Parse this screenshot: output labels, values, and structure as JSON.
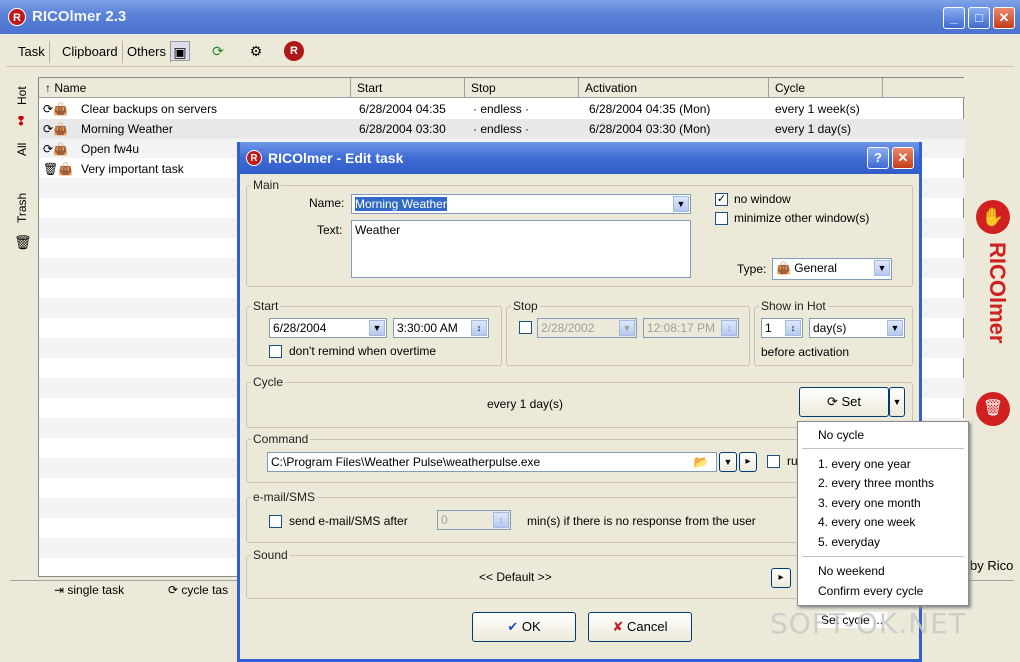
{
  "app": {
    "title": "RICOlmer 2.3",
    "logo": "R"
  },
  "toolbar": {
    "task": "Task",
    "clipboard": "Clipboard",
    "others": "Others"
  },
  "sidebar": {
    "hot": "Hot",
    "all": "All",
    "trash": "Trash"
  },
  "columns": [
    "Name",
    "Start",
    "Stop",
    "Activation",
    "Cycle"
  ],
  "rows": [
    {
      "name": "Clear backups on servers",
      "start": "6/28/2004 04:35",
      "stop": "· endless ·",
      "activation": "6/28/2004 04:35 (Mon)",
      "cycle": "every 1 week(s)"
    },
    {
      "name": "Morning Weather",
      "start": "6/28/2004 03:30",
      "stop": "· endless ·",
      "activation": "6/28/2004 03:30 (Mon)",
      "cycle": "every 1 day(s)"
    },
    {
      "name": "Open fw4u",
      "start": "",
      "stop": "",
      "activation": "",
      "cycle": ""
    },
    {
      "name": "Very important task",
      "start": "",
      "stop": "",
      "activation": "",
      "cycle": ""
    }
  ],
  "status": {
    "single": "single task",
    "cycle": "cycle tas"
  },
  "brand": {
    "text": "RICOlmer",
    "by": "by Rico"
  },
  "dialog": {
    "title": "RICOlmer - Edit task",
    "main_group": "Main",
    "name_label": "Name:",
    "name_value": "Morning Weather",
    "text_label": "Text:",
    "text_value": "Weather",
    "no_window": "no window",
    "minimize_other": "minimize other window(s)",
    "type_label": "Type:",
    "type_value": "General",
    "start_group": "Start",
    "start_date": "6/28/2004",
    "start_time": "3:30:00 AM",
    "dont_remind": "don't remind when overtime",
    "stop_group": "Stop",
    "stop_date": "2/28/2002",
    "stop_time": "12:08:17 PM",
    "hot_group": "Show in Hot",
    "hot_count": "1",
    "hot_unit": "day(s)",
    "before_activation": "before activation",
    "cycle_group": "Cycle",
    "cycle_value": "every 1 day(s)",
    "set_label": "Set",
    "command_group": "Command",
    "command_value": "C:\\Program Files\\Weather Pulse\\weatherpulse.exe",
    "run_label": "ru",
    "email_group": "e-mail/SMS",
    "send_email": "send e-mail/SMS after",
    "email_minutes": "0",
    "email_suffix": "min(s) if there is no response from the user",
    "sound_group": "Sound",
    "sound_value": "<< Default >>",
    "ok_label": "OK",
    "cancel_label": "Cancel"
  },
  "cycle_menu": {
    "no_cycle": "No cycle",
    "items": [
      "1. every one year",
      "2. every three months",
      "3. every one month",
      "4. every one week",
      "5. everyday"
    ],
    "no_weekend": "No weekend",
    "confirm": "Confirm every cycle",
    "set_cycle": "Set cycle ..."
  },
  "watermark": "SOFT-OK.NET"
}
